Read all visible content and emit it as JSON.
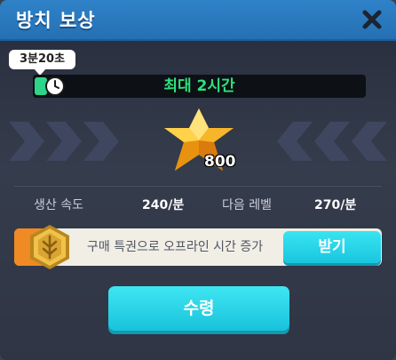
{
  "window": {
    "title": "방치 보상"
  },
  "timer": {
    "elapsed": "3분20초",
    "max_label": "최대 2시간"
  },
  "reward": {
    "amount": "800"
  },
  "stats": {
    "speed_label": "생산 속도",
    "speed_value": "240/분",
    "next_label": "다음 레벨",
    "next_value": "270/분"
  },
  "promo": {
    "text": "구매 특권으로 오프라인 시간 증가",
    "button_label": "받기"
  },
  "claim": {
    "label": "수령"
  },
  "icons": [
    "close-icon",
    "clock-icon",
    "star-crystal-icon",
    "coin-badge-icon",
    "chevron-icon"
  ],
  "colors": {
    "header": "#2f82c8",
    "accent_green": "#2ee07d",
    "button_cyan": "#1fcbe0",
    "promo_orange": "#f08a24"
  }
}
